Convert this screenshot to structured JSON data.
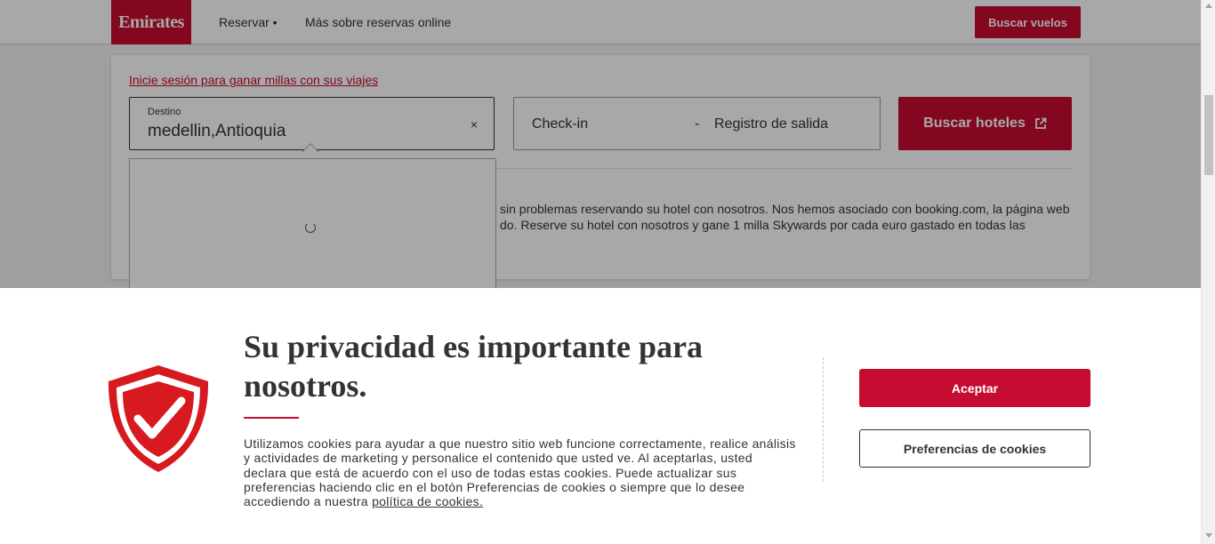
{
  "header": {
    "logo_text": "Emirates",
    "nav": [
      {
        "label": "Reservar •"
      },
      {
        "label": "Más sobre reservas online"
      }
    ],
    "cta_label": "Buscar vuelos"
  },
  "search": {
    "login_link": "Inicie sesión para ganar millas con sus viajes",
    "destination": {
      "label": "Destino",
      "value": "medellin,Antioquia",
      "clear_icon": "×"
    },
    "dates": {
      "checkin": "Check-in",
      "separator": "-",
      "checkout": "Registro de salida"
    },
    "submit_label": "Buscar hoteles",
    "description": "sin problemas reservando su hotel con nosotros. Nos hemos asociado con booking.com, la página web do. Reserve su hotel con nosotros y gane 1 milla Skywards por cada euro gastado en todas las"
  },
  "cookie_banner": {
    "title": "Su privacidad es importante para nosotros.",
    "body": "Utilizamos cookies para ayudar a que nuestro sitio web funcione correctamente, realice análisis y actividades de marketing y personalice el contenido que usted ve. Al aceptarlas, usted declara que está de acuerdo con el uso de todas estas cookies. Puede actualizar sus preferencias haciendo clic en el botón Preferencias de cookies o siempre que lo desee accediendo a nuestra",
    "link_text": "política de cookies.",
    "accept_label": "Aceptar",
    "preferences_label": "Preferencias de cookies"
  },
  "colors": {
    "brand_red": "#c60c30"
  },
  "icons": {
    "shield": "shield-check-icon",
    "external": "external-link-icon",
    "spinner": "loading-spinner-icon"
  }
}
